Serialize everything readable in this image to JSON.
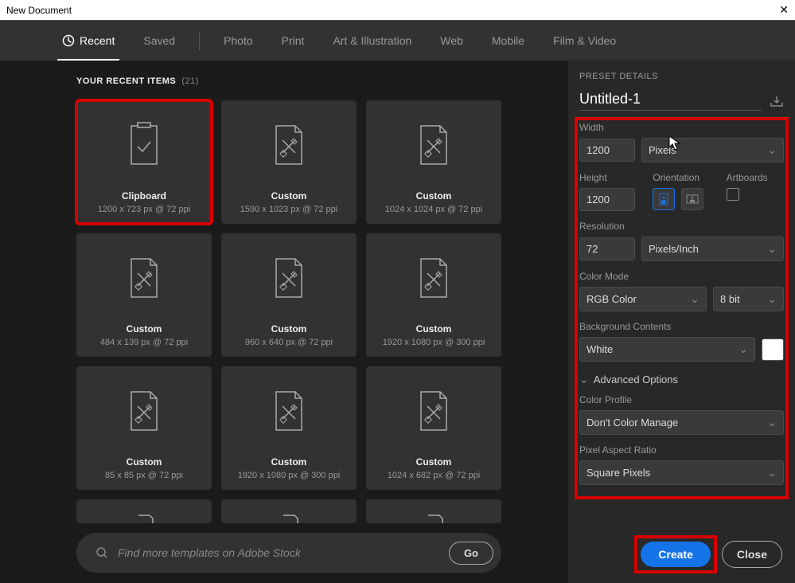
{
  "window": {
    "title": "New Document"
  },
  "tabs": {
    "recent": "Recent",
    "saved": "Saved",
    "photo": "Photo",
    "print": "Print",
    "art": "Art & Illustration",
    "web": "Web",
    "mobile": "Mobile",
    "film": "Film & Video"
  },
  "section": {
    "title": "YOUR RECENT ITEMS",
    "count": "(21)"
  },
  "cards": [
    {
      "label": "Clipboard",
      "sub": "1200 x 723 px @ 72 ppi"
    },
    {
      "label": "Custom",
      "sub": "1590 x 1023 px @ 72 ppi"
    },
    {
      "label": "Custom",
      "sub": "1024 x 1024 px @ 72 ppi"
    },
    {
      "label": "Custom",
      "sub": "484 x 139 px @ 72 ppi"
    },
    {
      "label": "Custom",
      "sub": "960 x 640 px @ 72 ppi"
    },
    {
      "label": "Custom",
      "sub": "1920 x 1080 px @ 300 ppi"
    },
    {
      "label": "Custom",
      "sub": "85 x 85 px @ 72 ppi"
    },
    {
      "label": "Custom",
      "sub": "1920 x 1080 px @ 300 ppi"
    },
    {
      "label": "Custom",
      "sub": "1024 x 682 px @ 72 ppi"
    }
  ],
  "search": {
    "placeholder": "Find more templates on Adobe Stock",
    "go": "Go"
  },
  "preset": {
    "header": "PRESET DETAILS",
    "name": "Untitled-1",
    "width_label": "Width",
    "width_value": "1200",
    "width_unit": "Pixels",
    "height_label": "Height",
    "height_value": "1200",
    "orientation_label": "Orientation",
    "artboards_label": "Artboards",
    "resolution_label": "Resolution",
    "resolution_value": "72",
    "resolution_unit": "Pixels/Inch",
    "colormode_label": "Color Mode",
    "colormode_value": "RGB Color",
    "colordepth": "8 bit",
    "bgcontents_label": "Background Contents",
    "bgcontents_value": "White",
    "advanced": "Advanced Options",
    "colorprofile_label": "Color Profile",
    "colorprofile_value": "Don't Color Manage",
    "pixelratio_label": "Pixel Aspect Ratio",
    "pixelratio_value": "Square Pixels"
  },
  "buttons": {
    "create": "Create",
    "close": "Close"
  }
}
